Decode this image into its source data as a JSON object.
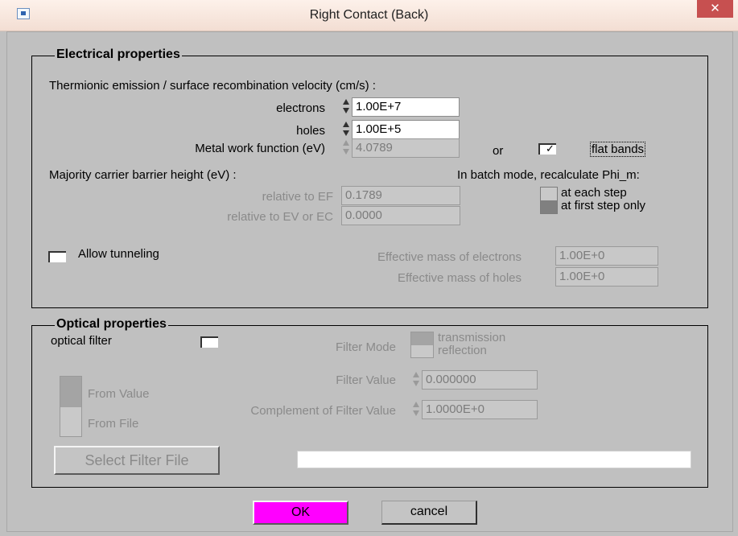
{
  "window": {
    "title": "Right Contact (Back)",
    "close_glyph": "✕"
  },
  "electrical": {
    "group_label": "Electrical properties",
    "thermionic_label": "Thermionic emission / surface recombination velocity (cm/s) :",
    "electrons_label": "electrons",
    "electrons_value": "1.00E+7",
    "holes_label": "holes",
    "holes_value": "1.00E+5",
    "work_function_label": "Metal work function (eV)",
    "work_function_value": "4.0789",
    "or_label": "or",
    "flat_bands_checked": true,
    "flat_bands_glyph": "✓",
    "flat_bands_label": "flat bands",
    "barrier_label": "Majority carrier barrier height (eV) :",
    "batch_label": "In batch mode, recalculate Phi_m:",
    "relative_ef_label": "relative to EF",
    "relative_ef_value": "0.1789",
    "relative_ev_label": "relative to EV or EC",
    "relative_ev_value": "0.0000",
    "recalc_options": [
      "at each step",
      "at first step only"
    ],
    "recalc_selected": "at first step only",
    "tunneling_label": "Allow tunneling",
    "tunneling_checked": false,
    "eff_mass_electrons_label": "Effective mass of electrons",
    "eff_mass_electrons_value": "1.00E+0",
    "eff_mass_holes_label": "Effective mass of holes",
    "eff_mass_holes_value": "1.00E+0"
  },
  "optical": {
    "group_label": "Optical properties",
    "filter_label": "optical filter",
    "filter_checked": false,
    "filter_mode_label": "Filter Mode",
    "filter_mode_options": [
      "transmission",
      "reflection"
    ],
    "source_options": [
      "From Value",
      "From File"
    ],
    "filter_value_label": "Filter Value",
    "filter_value": "0.000000",
    "complement_label": "Complement of Filter Value",
    "complement_value": "1.0000E+0",
    "select_file_label": "Select Filter File",
    "file_path": ""
  },
  "buttons": {
    "ok_label": "OK",
    "cancel_label": "cancel"
  },
  "colors": {
    "ok_button": "#ff00ff",
    "close_button": "#c75050",
    "background": "#c0c0c0"
  }
}
